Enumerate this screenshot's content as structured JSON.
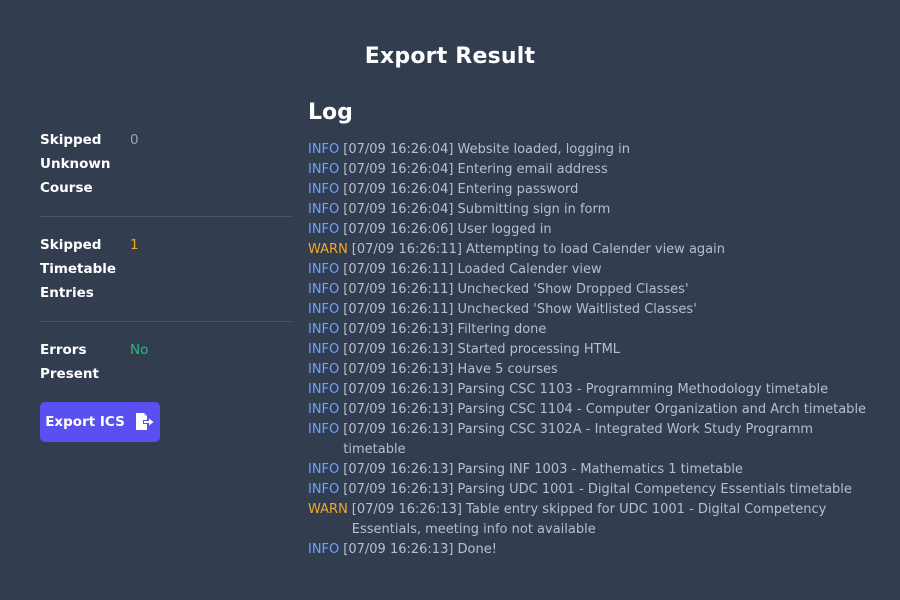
{
  "title": "Export Result",
  "stats": [
    {
      "label": "Skipped Unknown Course",
      "value": "0",
      "tone": "gray"
    },
    {
      "label": "Skipped Timetable Entries",
      "value": "1",
      "tone": "orange"
    },
    {
      "label": "Errors Present",
      "value": "No",
      "tone": "green"
    }
  ],
  "export_button": {
    "label": "Export ICS",
    "icon": "file-export-icon"
  },
  "log": {
    "title": "Log",
    "entries": [
      {
        "level": "INFO",
        "message": "[07/09 16:26:04] Website loaded, logging in"
      },
      {
        "level": "INFO",
        "message": "[07/09 16:26:04] Entering email address"
      },
      {
        "level": "INFO",
        "message": "[07/09 16:26:04] Entering password"
      },
      {
        "level": "INFO",
        "message": "[07/09 16:26:04] Submitting sign in form"
      },
      {
        "level": "INFO",
        "message": "[07/09 16:26:06] User logged in"
      },
      {
        "level": "WARN",
        "message": "[07/09 16:26:11] Attempting to load Calender view again"
      },
      {
        "level": "INFO",
        "message": "[07/09 16:26:11] Loaded Calender view"
      },
      {
        "level": "INFO",
        "message": "[07/09 16:26:11] Unchecked 'Show Dropped Classes'"
      },
      {
        "level": "INFO",
        "message": "[07/09 16:26:11] Unchecked 'Show Waitlisted Classes'"
      },
      {
        "level": "INFO",
        "message": "[07/09 16:26:13] Filtering done"
      },
      {
        "level": "INFO",
        "message": "[07/09 16:26:13] Started processing HTML"
      },
      {
        "level": "INFO",
        "message": "[07/09 16:26:13] Have 5 courses"
      },
      {
        "level": "INFO",
        "message": "[07/09 16:26:13] Parsing CSC 1103 - Programming Methodology timetable"
      },
      {
        "level": "INFO",
        "message": "[07/09 16:26:13] Parsing CSC 1104 - Computer Organization and Arch timetable"
      },
      {
        "level": "INFO",
        "message": "[07/09 16:26:13] Parsing CSC 3102A - Integrated Work Study Programm timetable"
      },
      {
        "level": "INFO",
        "message": "[07/09 16:26:13] Parsing INF 1003 - Mathematics 1 timetable"
      },
      {
        "level": "INFO",
        "message": "[07/09 16:26:13] Parsing UDC 1001 - Digital Competency Essentials timetable"
      },
      {
        "level": "WARN",
        "message": "[07/09 16:26:13] Table entry skipped for UDC 1001 - Digital Competency Essentials, meeting info not available"
      },
      {
        "level": "INFO",
        "message": "[07/09 16:26:13] Done!"
      }
    ]
  },
  "colors": {
    "background": "#323d50",
    "accent": "#5a4ff0",
    "info": "#6ea2ff",
    "warn": "#f0a92e",
    "success": "#2cb878"
  }
}
